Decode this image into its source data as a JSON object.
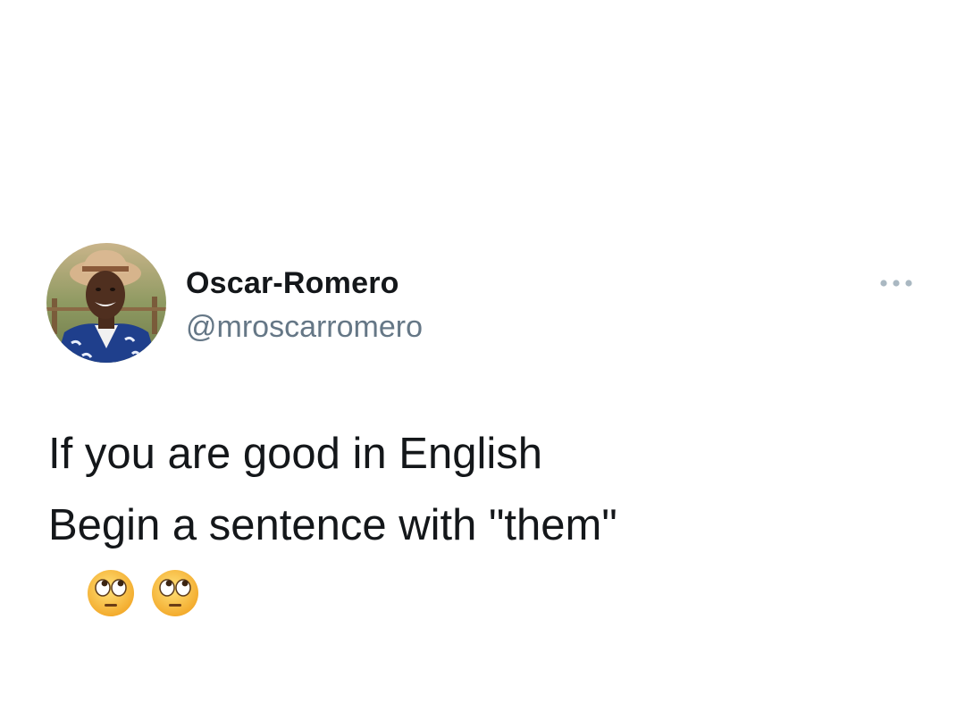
{
  "tweet": {
    "author": {
      "display_name": "Oscar-Romero",
      "handle": "@mroscarromero",
      "avatar_icon": "profile-photo"
    },
    "more_icon": "more-options-ellipsis",
    "text_lines": [
      "If you are good in English",
      "Begin a sentence with \"them\""
    ],
    "emojis": [
      "face-with-rolling-eyes",
      "face-with-rolling-eyes"
    ]
  },
  "colors": {
    "text_primary": "#14171a",
    "text_secondary": "#657786",
    "background": "#ffffff"
  }
}
